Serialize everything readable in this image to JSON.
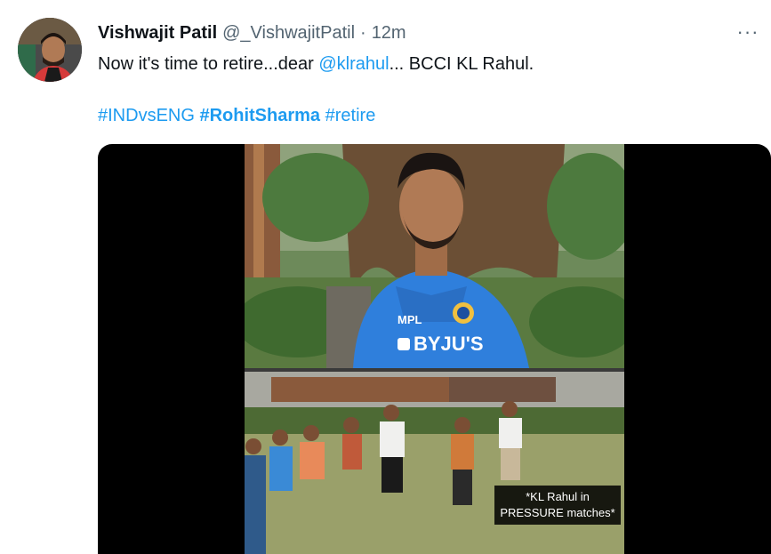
{
  "tweet": {
    "author_name": "Vishwajit Patil",
    "author_handle": "@_VishwajitPatil",
    "separator": "·",
    "timestamp": "12m",
    "more_label": "···",
    "text_before": "Now it's time to retire...dear ",
    "mention": "@klrahul",
    "text_after": "... BCCI KL Rahul.",
    "hashtags": [
      {
        "text": "#INDvsENG",
        "bold": false
      },
      {
        "text": "#RohitSharma",
        "bold": true
      },
      {
        "text": "#retire",
        "bold": false
      }
    ],
    "media": {
      "jersey_sponsor": "BYJU'S",
      "jersey_brand": "MPL",
      "caption_line1": "*KL Rahul in",
      "caption_line2": "PRESSURE matches*"
    }
  },
  "colors": {
    "link": "#1d9bf0",
    "secondary_text": "#536471",
    "jersey": "#2f7fdc"
  }
}
